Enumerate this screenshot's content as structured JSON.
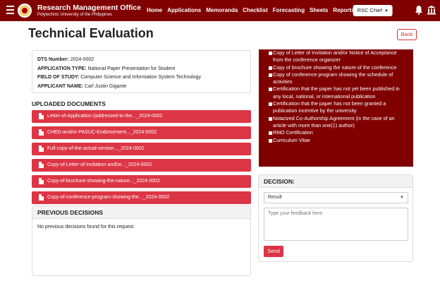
{
  "header": {
    "brand_title": "Research Management Office",
    "brand_subtitle": "Polytechnic University of the Philippines",
    "nav": [
      "Home",
      "Applications",
      "Memoranda",
      "Checklist",
      "Forecasting",
      "Sheets",
      "Reports"
    ],
    "role": "RSC Chief",
    "icons": [
      "menu-icon",
      "university-logo",
      "bell-icon",
      "institution-icon"
    ]
  },
  "page": {
    "title": "Technical Evaluation",
    "back_label": "Back"
  },
  "info": {
    "dts_label": "DTS Number:",
    "dts_value": "2024-0002",
    "type_label": "APPLICATION TYPE:",
    "type_value": "National Paper Presentation for Student",
    "field_label": "FIELD OF STUDY:",
    "field_value": "Computer Science and Information System Technology",
    "name_label": "APPLICANT NAME:",
    "name_value": "Carl Justin Gigante"
  },
  "uploaded": {
    "heading": "UPLOADED DOCUMENTS",
    "docs": [
      "Letter-of-Application-(addressed-to-the..._2024-0002",
      "CHED-and/or-PASUC-Endorsement..._2024-0002",
      "Full-copy-of-the-actual-version..._2024-0002",
      "Copy-of-Letter-of-Invitation-and/or..._2024-0002",
      "Copy-of-brochure-showing-the-nature..._2024-0002",
      "Copy-of-conference-program-showing-the..._2024-0002"
    ]
  },
  "previous": {
    "heading": "PREVIOUS DECISIONS",
    "empty_text": "No previous decisions found for this request."
  },
  "requirements": [
    "Copy of Letter of Invitation and/or Notice of Acceptance from the conference organizer",
    "Copy of brochure showing the nature of the conference",
    "Copy of conference program showing the schedule of activities",
    "Certification that the paper has not yet been published in any local, national, or international publication",
    "Certification that the paper has not been granted a publication incentive by the university",
    "Notarized Co-Authorship Agreement (in the case of an article with more than one(1) author)",
    "RMO Certification",
    "Curriculum Vitae"
  ],
  "decision": {
    "heading": "DECISION:",
    "select_value": "Result",
    "textarea_placeholder": "Type your feedback here.",
    "send_label": "Send"
  },
  "colors": {
    "brand": "#800000",
    "accent": "#dc3545"
  }
}
